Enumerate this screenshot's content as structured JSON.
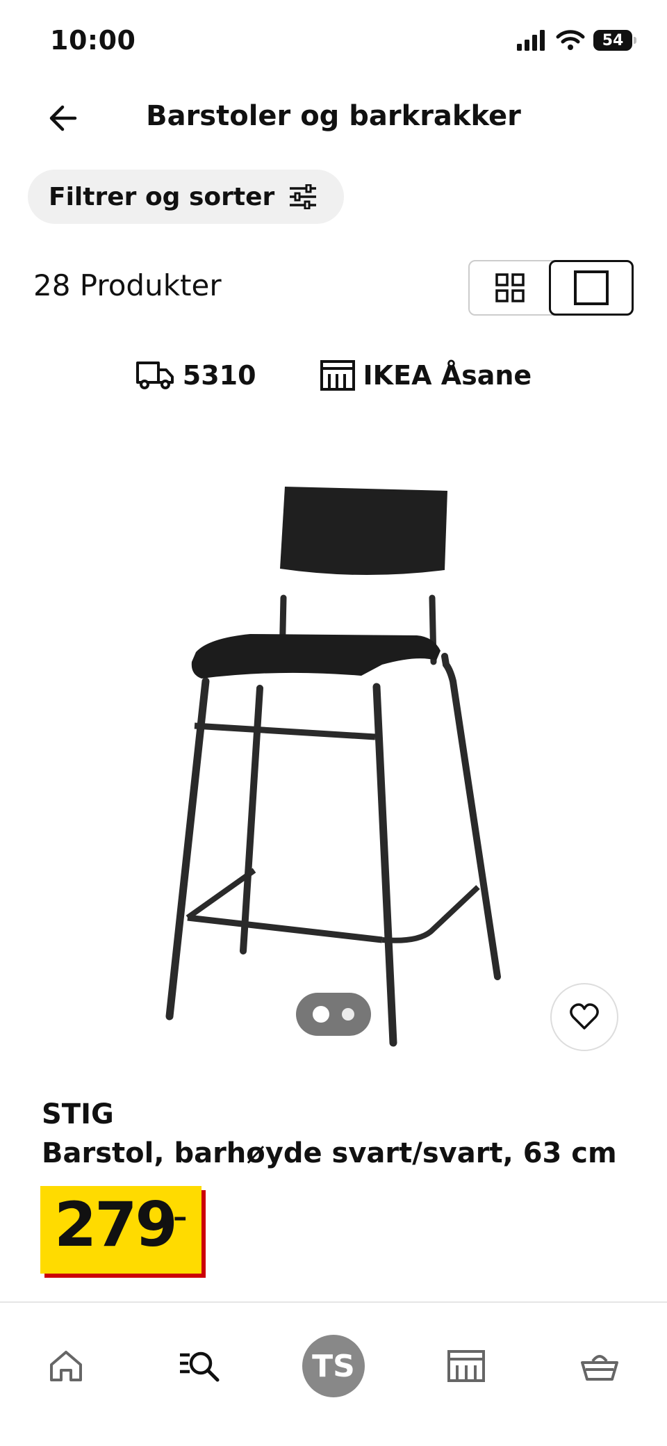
{
  "status": {
    "time": "10:00",
    "battery": "54"
  },
  "header": {
    "title": "Barstoler og barkrakker"
  },
  "filter": {
    "label": "Filtrer og sorter"
  },
  "results": {
    "count": "28 Produkter"
  },
  "delivery": {
    "postcode": "5310",
    "store": "IKEA Åsane"
  },
  "product": {
    "brand": "STIG",
    "description": "Barstol, barhøyde svart/svart, 63 cm",
    "price": "279",
    "price_suffix": ",–",
    "image_count": 2,
    "current_image": 1
  },
  "nav": {
    "avatar": "TS"
  },
  "colors": {
    "price_bg": "#ffdb00",
    "price_shadow": "#cc0008",
    "accent": "#111111"
  }
}
